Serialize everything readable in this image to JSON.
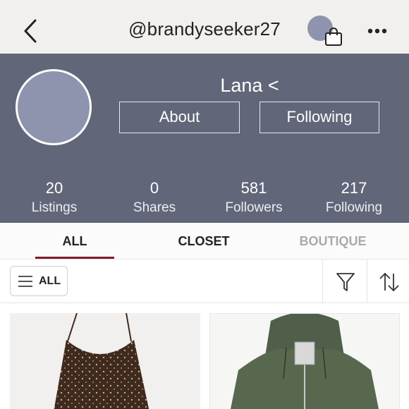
{
  "header": {
    "username": "@brandyseeker27",
    "back_icon": "chevron-left-icon",
    "bag_icon": "shopping-bag-icon",
    "more_icon": "more-horizontal-icon"
  },
  "profile": {
    "name": "Lana <",
    "about_label": "About",
    "following_button_label": "Following",
    "stats": [
      {
        "count": "20",
        "label": "Listings"
      },
      {
        "count": "0",
        "label": "Shares"
      },
      {
        "count": "581",
        "label": "Followers"
      },
      {
        "count": "217",
        "label": "Following"
      }
    ]
  },
  "tabs": [
    {
      "label": "ALL",
      "active": true
    },
    {
      "label": "CLOSET",
      "active": false
    },
    {
      "label": "BOUTIQUE",
      "active": false
    }
  ],
  "filter_bar": {
    "all_filter_label": "ALL",
    "filter_icon": "filter-funnel-icon",
    "sort_icon": "sort-arrows-icon"
  },
  "listings": [
    {
      "image": "brown-floral-slip-dress"
    },
    {
      "image": "green-zip-hoodie"
    }
  ],
  "colors": {
    "accent": "#7f1c2c",
    "profile_bg": "#626679",
    "avatar": "#8e94ad",
    "topbar_bg": "#f2f0ee"
  }
}
